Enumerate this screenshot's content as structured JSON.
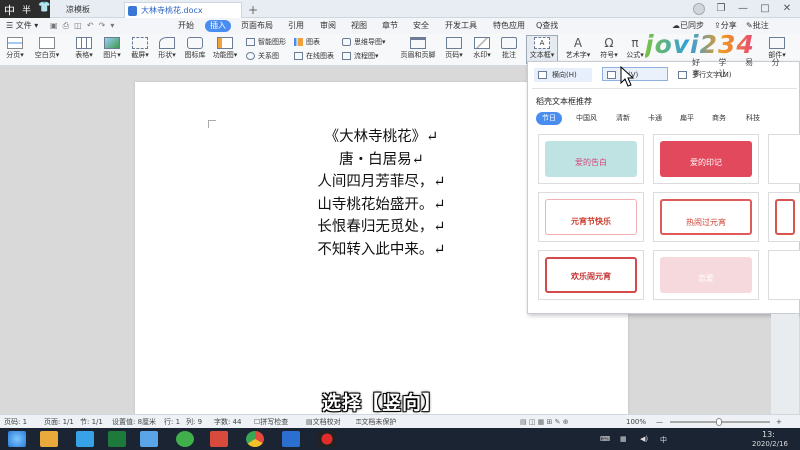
{
  "ime": {
    "char1": "中",
    "char2": "半"
  },
  "titlebar": {
    "tabs": [
      {
        "label": "凉模板",
        "active": false
      },
      {
        "label": "大林寺桃花.docx",
        "active": true
      }
    ],
    "tab_plus": "+",
    "win_controls": {
      "restore": "❐",
      "minimize": "—",
      "maximize": "□",
      "close": "✕"
    }
  },
  "menubar": {
    "file": "文件",
    "items": [
      "开始",
      "插入",
      "页面布局",
      "引用",
      "审阅",
      "视图",
      "章节",
      "安全",
      "开发工具",
      "特色应用"
    ],
    "search": "Q查找",
    "right": {
      "sync": "已同步",
      "share": "分享",
      "comment": "批注"
    }
  },
  "ribbon": {
    "groups": {
      "page_sep": "分页▾",
      "blank_page": "空白页▾",
      "table": "表格▾",
      "picture": "图片▾",
      "screenshot": "截屏▾",
      "shape": "形状▾",
      "icon_lib": "图标库",
      "function_chart": "功能图▾",
      "smart_shape": "智能图形",
      "chart": "图表",
      "mind_map": "思维导图▾",
      "relation_chart": "关系图",
      "online_chart": "在线图表",
      "flow_chart": "流程图▾",
      "header_footer": "页眉和页脚",
      "page_number": "页码▾",
      "watermark": "水印▾",
      "annotation": "批注",
      "textbox": "文本框▾",
      "art_text": "艺术字▾",
      "symbol": "符号▾",
      "formula": "公式▾",
      "parts": "部件▾"
    }
  },
  "document": {
    "poem": [
      "《大林寺桃花》↵",
      "唐・白居易↵",
      "人间四月芳菲尽，↵",
      "山寺桃花始盛开。↵",
      "长恨春归无觅处，↵",
      "不知转入此中来。↵"
    ]
  },
  "textbox_panel": {
    "horizontal": "横向(H)",
    "vertical": "向(V)",
    "multiline": "多行文字(M)",
    "recommend_title": "稻壳文本框推荐",
    "categories": [
      "节日",
      "中国风",
      "清新",
      "卡通",
      "扁平",
      "商务",
      "科技"
    ],
    "cards": [
      {
        "text": "爱的告白"
      },
      {
        "text": "爱的印记"
      },
      {
        "text": "元宵节快乐"
      },
      {
        "text": "热闹过元宵"
      },
      {
        "text": "欢乐闹元宵"
      },
      {
        "text": "恋爱"
      }
    ]
  },
  "statusbar": {
    "page_num": "页码: 1",
    "pages": "页面: 1/1",
    "section": "节: 1/1",
    "setting": "设置值: 8厘米",
    "row": "行: 1",
    "col": "列: 9",
    "words": "字数: 44",
    "spell": "拼写检查",
    "proof": "文档校对",
    "protect": "文档未保护",
    "zoom": "100%",
    "zoom_minus": "—",
    "zoom_plus": "+"
  },
  "taskbar": {
    "time": "13:",
    "date": "2020/2/16"
  },
  "subtitle": "选择【竖向】",
  "watermark": {
    "text": "jovi234",
    "sub": "好 学 易 分 享 让"
  },
  "colors": {
    "accent": "#4a8df0",
    "wm_green": "#7dc242",
    "wm_blue": "#2f9ee0",
    "wm_orange": "#f29a1f",
    "wm_pink": "#e8457a"
  }
}
